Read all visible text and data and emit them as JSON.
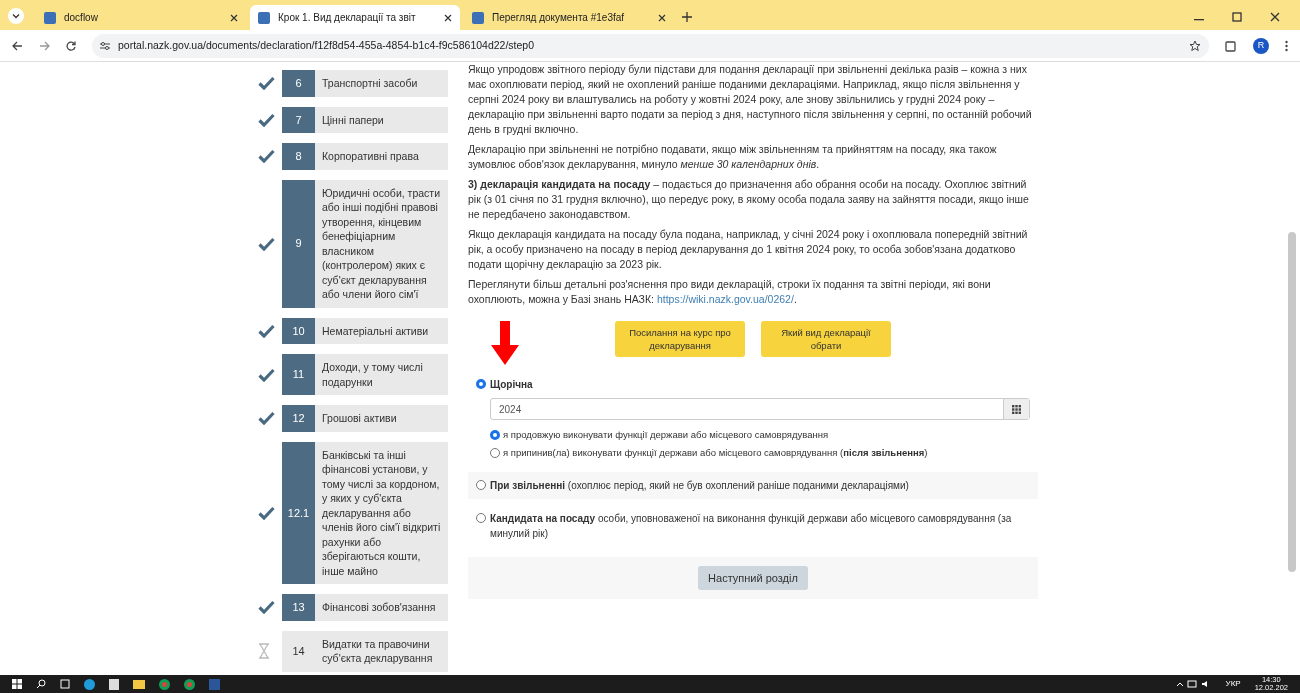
{
  "browser": {
    "tabs": [
      {
        "title": "docflow",
        "selected": false
      },
      {
        "title": "Крок 1. Вид декларації та звіт",
        "selected": true
      },
      {
        "title": "Перегляд документа #1e3faf",
        "selected": false
      }
    ],
    "url": "portal.nazk.gov.ua/documents/declaration/f12f8d54-455a-4854-b1c4-f9c586104d22/step0",
    "profile": "R"
  },
  "sidebar": {
    "items": [
      {
        "number": "6",
        "label": "Транспортні засоби",
        "kind": "done"
      },
      {
        "number": "7",
        "label": "Цінні папери",
        "kind": "done"
      },
      {
        "number": "8",
        "label": "Корпоративні права",
        "kind": "done"
      },
      {
        "number": "9",
        "label": "Юридичні особи, трасти або інші подібні правові утворення, кінцевим бенефіціарним власником (контролером) яких є суб'єкт декларування або члени його сім'ї",
        "kind": "done"
      },
      {
        "number": "10",
        "label": "Нематеріальні активи",
        "kind": "done"
      },
      {
        "number": "11",
        "label": "Доходи, у тому числі подарунки",
        "kind": "done"
      },
      {
        "number": "12",
        "label": "Грошові активи",
        "kind": "done"
      },
      {
        "number": "12.1",
        "label": "Банківські та інші фінансові установи, у тому числі за кордоном, у яких у суб'єкта декларування або членів його сім'ї відкриті рахунки або зберігаються кошти, інше майно",
        "kind": "done"
      },
      {
        "number": "13",
        "label": "Фінансові зобов'язання",
        "kind": "done"
      },
      {
        "number": "14",
        "label": "Видатки та правочини суб'єкта декларування",
        "kind": "pending"
      }
    ]
  },
  "info": {
    "paragraphs": [
      {
        "text": "Якщо упродовж звітного періоду були підстави для подання декларації при звільненні декілька разів – кожна з них має охоплювати період, який не охоплений раніше поданими деклараціями. Наприклад, якщо після звільнення у серпні 2024 року ви влаштувались на роботу у жовтні 2024 року, але знову звільнились у грудні 2024 року – декларацію при звільненні варто подати за період з дня, наступного після звільнення у серпні, по останній робочий день в грудні включно."
      },
      {
        "text": "Декларацію при звільненні не потрібно подавати, якщо між звільненням та прийняттям на посаду, яка також зумовлює обов'язок декларування, минуло *менше 30 календарних днів*."
      },
      {
        "text": "**3) декларація кандидата на посаду** – подається до призначення або обрання особи на посаду. Охоплює звітний рік (з 01 січня по 31 грудня включно), що передує року, в якому особа подала заяву на зайняття посади, якщо інше не передбачено законодавством."
      },
      {
        "text": "Якщо декларація кандидата на посаду була подана, наприклад, у січні 2024 року і охоплювала попередній звітний рік, а особу призначено на посаду в період декларування до 1 квітня 2024 року, то особа зобов'язана додатково подати щорічну декларацію за 2023 рік."
      },
      {
        "text": "Переглянути більш детальні роз'яснення про види декларацій, строки їх подання та звітні періоди, які вони охоплюють, можна у Базі знань НАЗК: ",
        "link": "https://wiki.nazk.gov.ua/0262/",
        "after": "."
      }
    ],
    "buttons": [
      "Посилання на курс про декларування",
      "Який вид декларації обрати"
    ]
  },
  "options": [
    {
      "title": "Щорічна",
      "selected": true,
      "year": "2024",
      "sub_options": [
        {
          "text": "я продовжую виконувати функції держави або місцевого самоврядування",
          "selected": true
        },
        {
          "text": "я припинив(ла) виконувати функції держави або місцевого самоврядування (**після звільнення**)",
          "selected": false
        }
      ]
    },
    {
      "title": "При звільненні",
      "note": " (охоплює період, який не був охоплений раніше поданими деклараціями)",
      "selected": false
    },
    {
      "title": "Кандидата на посаду",
      "note": " особи, уповноваженої на виконання функцій держави або місцевого самоврядування (за минулий рік)",
      "selected": false
    }
  ],
  "next_button": "Наступний розділ",
  "taskbar": {
    "language": "УКР",
    "time": "14:30",
    "date": "12.02.202"
  }
}
